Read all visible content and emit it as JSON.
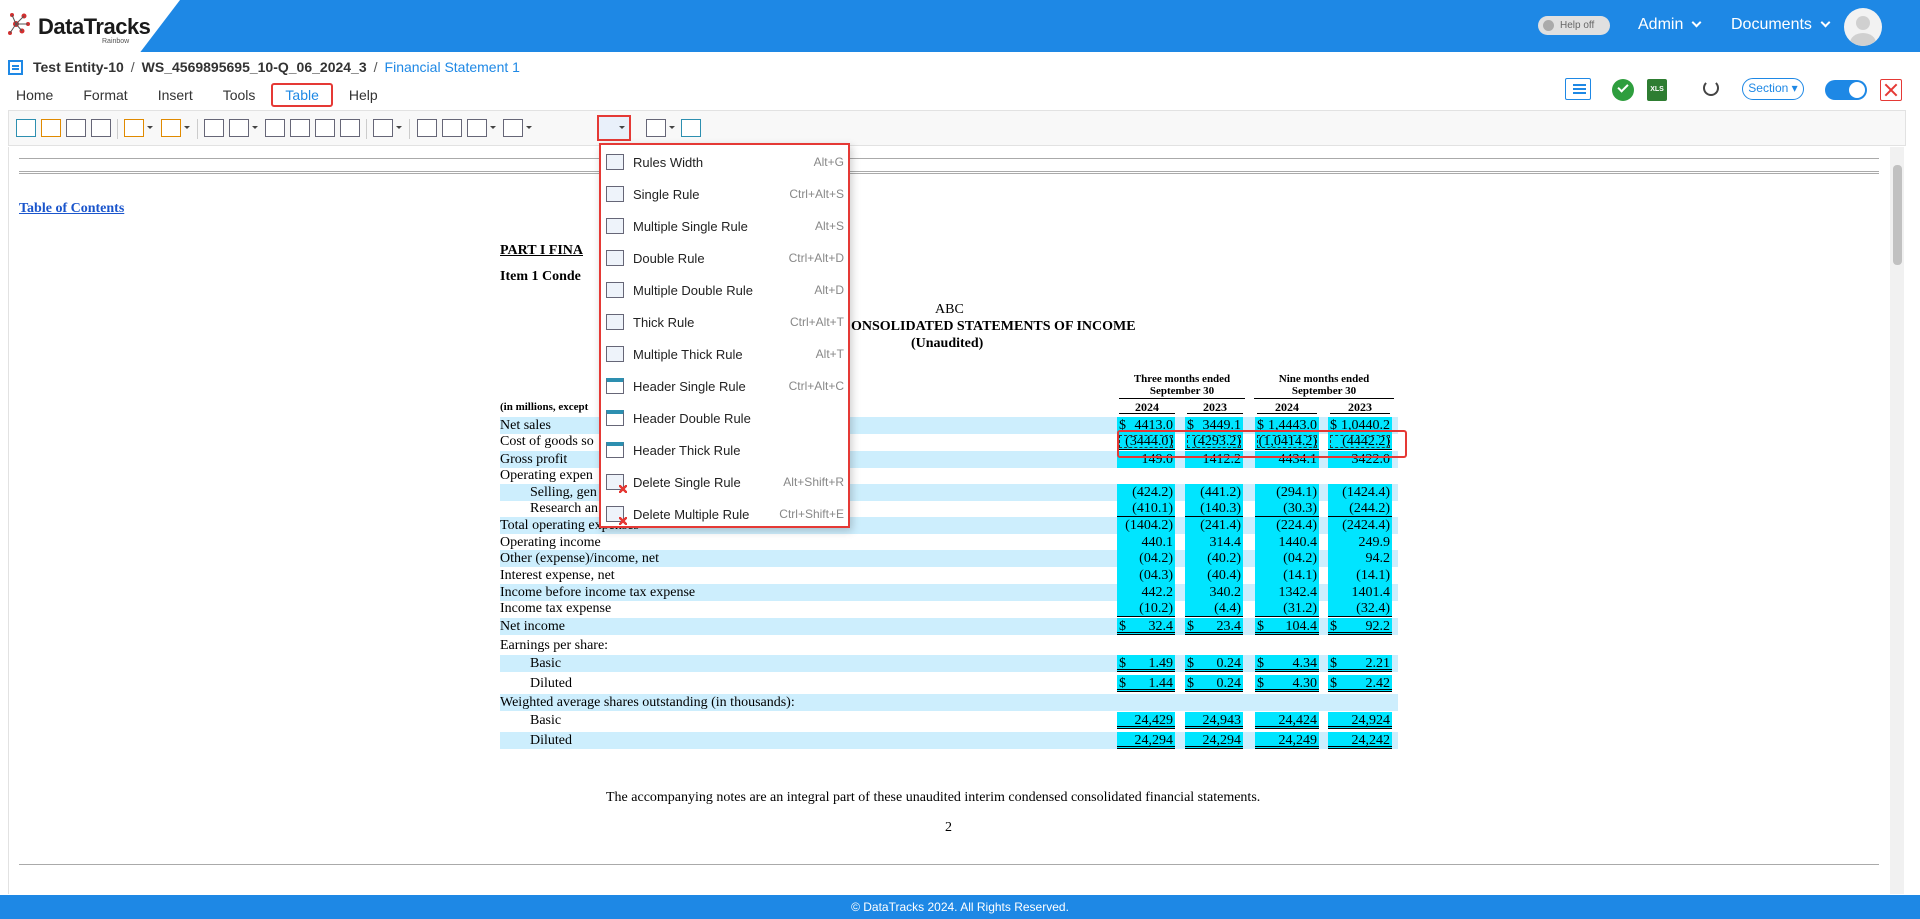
{
  "app": {
    "logo_text": "DataTracks",
    "logo_sub": "Rainbow"
  },
  "topbar": {
    "help_toggle": "Help off",
    "admin": "Admin",
    "documents": "Documents"
  },
  "breadcrumb": {
    "entity": "Test Entity-10",
    "workspace": "WS_4569895695_10-Q_06_2024_3",
    "separator": "/",
    "statement": "Financial Statement 1"
  },
  "menu": [
    "Home",
    "Format",
    "Insert",
    "Tools",
    "Table",
    "Help"
  ],
  "active_menu": "Table",
  "right_tools": {
    "section": "Section"
  },
  "dropdown": [
    {
      "label": "Rules Width",
      "shortcut": "Alt+G",
      "icon": "rules-width-icon"
    },
    {
      "label": "Single Rule",
      "shortcut": "Ctrl+Alt+S",
      "icon": "single-rule-icon"
    },
    {
      "label": "Multiple Single Rule",
      "shortcut": "Alt+S",
      "icon": "multiple-single-rule-icon"
    },
    {
      "label": "Double Rule",
      "shortcut": "Ctrl+Alt+D",
      "icon": "double-rule-icon"
    },
    {
      "label": "Multiple Double Rule",
      "shortcut": "Alt+D",
      "icon": "multiple-double-rule-icon"
    },
    {
      "label": "Thick Rule",
      "shortcut": "Ctrl+Alt+T",
      "icon": "thick-rule-icon"
    },
    {
      "label": "Multiple Thick Rule",
      "shortcut": "Alt+T",
      "icon": "multiple-thick-rule-icon"
    },
    {
      "label": "Header Single Rule",
      "shortcut": "Ctrl+Alt+C",
      "icon": "header-single-rule-icon"
    },
    {
      "label": "Header Double Rule",
      "shortcut": "",
      "icon": "header-double-rule-icon"
    },
    {
      "label": "Header Thick Rule",
      "shortcut": "",
      "icon": "header-thick-rule-icon"
    },
    {
      "label": "Delete Single Rule",
      "shortcut": "Alt+Shift+R",
      "icon": "delete-single-rule-icon"
    },
    {
      "label": "Delete Multiple Rule",
      "shortcut": "Ctrl+Shift+E",
      "icon": "delete-multiple-rule-icon"
    }
  ],
  "doc": {
    "toc": "Table of Contents",
    "part": "PART I    FINA",
    "item": "Item 1    Conde",
    "company": "ABC",
    "title": "ONSOLIDATED STATEMENTS OF INCOME",
    "subtitle": "(Unaudited)",
    "units": "(in millions, except",
    "col_group1": "Three months ended September 30",
    "col_group2": "Nine months ended September 30",
    "years": [
      "2024",
      "2023",
      "2024",
      "2023"
    ],
    "rows": [
      {
        "label": "Net sales",
        "vals": [
          "4413.0",
          "3449.1",
          "1,4443.0",
          "1,0440.2"
        ],
        "dollar": true
      },
      {
        "label": "Cost of goods so",
        "vals": [
          "(3444.0)",
          "(4293.2)",
          "(1,0414.2)",
          "(4442.2)"
        ]
      },
      {
        "label": "Gross profit",
        "vals": [
          "149.0",
          "1412.2",
          "4434.1",
          "3422.0"
        ]
      },
      {
        "label": "Operating expen",
        "vals": [
          "",
          "",
          "",
          ""
        ]
      },
      {
        "label": "Selling, gen",
        "vals": [
          "(424.2)",
          "(441.2)",
          "(294.1)",
          "(1424.4)"
        ],
        "indent": true
      },
      {
        "label": "Research an",
        "vals": [
          "(410.1)",
          "(140.3)",
          "(30.3)",
          "(244.2)"
        ],
        "indent": true
      },
      {
        "label": "Total operating expenses",
        "vals": [
          "(1404.2)",
          "(241.4)",
          "(224.4)",
          "(2424.4)"
        ]
      },
      {
        "label": "Operating income",
        "vals": [
          "440.1",
          "314.4",
          "1440.4",
          "249.9"
        ]
      },
      {
        "label": "Other (expense)/income, net",
        "vals": [
          "(04.2)",
          "(40.2)",
          "(04.2)",
          "94.2"
        ]
      },
      {
        "label": "Interest expense, net",
        "vals": [
          "(04.3)",
          "(40.4)",
          "(14.1)",
          "(14.1)"
        ]
      },
      {
        "label": "Income before income tax expense",
        "vals": [
          "442.2",
          "340.2",
          "1342.4",
          "1401.4"
        ]
      },
      {
        "label": "Income tax expense",
        "vals": [
          "(10.2)",
          "(4.4)",
          "(31.2)",
          "(32.4)"
        ]
      },
      {
        "label": "Net income",
        "vals": [
          "32.4",
          "23.4",
          "104.4",
          "92.2"
        ],
        "dollar": true
      },
      {
        "label": "Earnings per share:",
        "vals": [
          "",
          "",
          "",
          ""
        ]
      },
      {
        "label": "Basic",
        "vals": [
          "1.49",
          "0.24",
          "4.34",
          "2.21"
        ],
        "dollar": true,
        "indent": true
      },
      {
        "label": "Diluted",
        "vals": [
          "1.44",
          "0.24",
          "4.30",
          "2.42"
        ],
        "dollar": true,
        "indent": true
      },
      {
        "label": "Weighted average shares outstanding (in thousands):",
        "vals": [
          "",
          "",
          "",
          ""
        ]
      },
      {
        "label": "Basic",
        "vals": [
          "24,429",
          "24,943",
          "24,424",
          "24,924"
        ],
        "indent": true
      },
      {
        "label": "Diluted",
        "vals": [
          "24,294",
          "24,294",
          "24,249",
          "24,242"
        ],
        "indent": true
      }
    ],
    "note": "The accompanying notes are an integral part of these unaudited interim condensed consolidated financial statements.",
    "page_no": "2"
  },
  "footer": "© DataTracks 2024. All Rights Reserved."
}
